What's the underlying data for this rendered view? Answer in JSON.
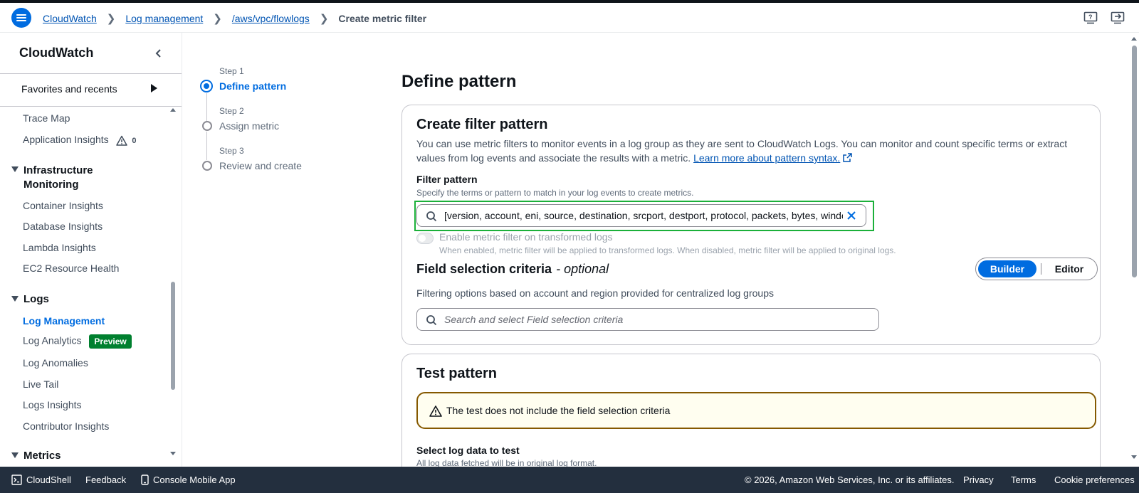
{
  "breadcrumb": {
    "items": [
      "CloudWatch",
      "Log management",
      "/aws/vpc/flowlogs"
    ],
    "current": "Create metric filter"
  },
  "sidebar": {
    "title": "CloudWatch",
    "favorites": "Favorites and recents",
    "items_top": [
      "Trace Map",
      "Application Insights"
    ],
    "app_insights_count": "0",
    "infra_section": "Infrastructure Monitoring",
    "infra_items": [
      "Container Insights",
      "Database Insights",
      "Lambda Insights",
      "EC2 Resource Health"
    ],
    "logs_section": "Logs",
    "logs_items": [
      "Log Management",
      "Log Analytics",
      "Log Anomalies",
      "Live Tail",
      "Logs Insights",
      "Contributor Insights"
    ],
    "preview_badge": "Preview",
    "metrics_section": "Metrics"
  },
  "steps": [
    {
      "step": "Step 1",
      "name": "Define pattern"
    },
    {
      "step": "Step 2",
      "name": "Assign metric"
    },
    {
      "step": "Step 3",
      "name": "Review and create"
    }
  ],
  "main": {
    "page_title": "Define pattern",
    "create_card": {
      "title": "Create filter pattern",
      "description": "You can use metric filters to monitor events in a log group as they are sent to CloudWatch Logs. You can monitor and count specific terms or extract values from log events and associate the results with a metric.",
      "link": "Learn more about pattern syntax.",
      "filter_label": "Filter pattern",
      "filter_hint": "Specify the terms or pattern to match in your log events to create metrics.",
      "filter_value": "[version, account, eni, source, destination, srcport, destport, protocol, packets, bytes, windowstart, windowend, action, flowlogstatus]",
      "toggle_label": "Enable metric filter on transformed logs",
      "toggle_desc": "When enabled, metric filter will be applied to transformed logs. When disabled, metric filter will be applied to original logs.",
      "field_title": "Field selection criteria",
      "field_optional": "- optional",
      "seg_builder": "Builder",
      "seg_editor": "Editor",
      "field_desc": "Filtering options based on account and region provided for centralized log groups",
      "field_placeholder": "Search and select Field selection criteria"
    },
    "test_card": {
      "title": "Test pattern",
      "alert": "The test does not include the field selection criteria",
      "select_label": "Select log data to test",
      "select_hint": "All log data fetched will be in original log format."
    }
  },
  "footer": {
    "cloudshell": "CloudShell",
    "feedback": "Feedback",
    "mobile": "Console Mobile App",
    "copyright": "© 2026, Amazon Web Services, Inc. or its affiliates.",
    "privacy": "Privacy",
    "terms": "Terms",
    "cookies": "Cookie preferences"
  },
  "colors": {
    "accent": "#006ce0",
    "link": "#0054b3",
    "highlight": "#1bb03a",
    "warning": "#855900",
    "footer_bg": "#232f3e"
  }
}
